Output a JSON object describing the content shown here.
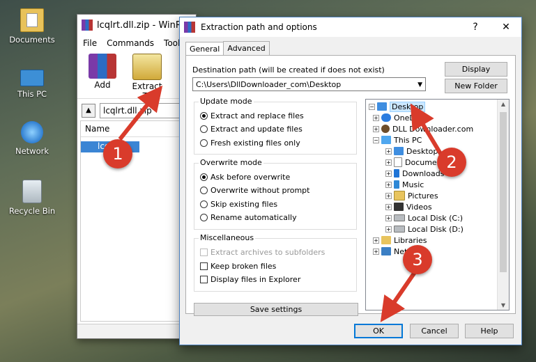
{
  "desktop": {
    "icons": [
      {
        "label": "Documents",
        "icon": "documents-folder-icon"
      },
      {
        "label": "This PC",
        "icon": "computer-icon"
      },
      {
        "label": "Network",
        "icon": "network-icon"
      },
      {
        "label": "Recycle Bin",
        "icon": "recycle-bin-icon"
      }
    ]
  },
  "winrar": {
    "title": "lcqlrt.dll.zip - WinRA",
    "menu": [
      "File",
      "Commands",
      "Tools"
    ],
    "toolbar": {
      "add": "Add",
      "extract_to": "Extract To"
    },
    "address": "lcqlrt.dll.zip",
    "column_name": "Name",
    "file_row": "lcq"
  },
  "dialog": {
    "title": "Extraction path and options",
    "help_glyph": "?",
    "close_glyph": "✕",
    "tabs": [
      "General",
      "Advanced"
    ],
    "dest_label": "Destination path (will be created if does not exist)",
    "dest_value": "C:\\Users\\DllDownloader_com\\Desktop",
    "display_btn": "Display",
    "new_folder_btn": "New Folder",
    "update_mode": {
      "title": "Update mode",
      "options": [
        "Extract and replace files",
        "Extract and update files",
        "Fresh existing files only"
      ],
      "selected": 0
    },
    "overwrite_mode": {
      "title": "Overwrite mode",
      "options": [
        "Ask before overwrite",
        "Overwrite without prompt",
        "Skip existing files",
        "Rename automatically"
      ],
      "selected": 0
    },
    "misc": {
      "title": "Miscellaneous",
      "options": [
        "Extract archives to subfolders",
        "Keep broken files",
        "Display files in Explorer"
      ]
    },
    "save_settings": "Save settings",
    "tree": [
      {
        "label": "Desktop",
        "selected": true
      },
      {
        "label": "OneD"
      },
      {
        "label": "DLL Downloader.com"
      },
      {
        "label": "This PC"
      },
      {
        "label": "Desktop"
      },
      {
        "label": "Documen"
      },
      {
        "label": "Downloads"
      },
      {
        "label": "Music"
      },
      {
        "label": "Pictures"
      },
      {
        "label": "Videos"
      },
      {
        "label": "Local Disk (C:)"
      },
      {
        "label": "Local Disk (D:)"
      },
      {
        "label": "Libraries"
      },
      {
        "label": "Netw"
      }
    ],
    "ok": "OK",
    "cancel": "Cancel",
    "help": "Help"
  },
  "annotations": {
    "step1": "1",
    "step2": "2",
    "step3": "3",
    "color": "#d93b2b"
  }
}
